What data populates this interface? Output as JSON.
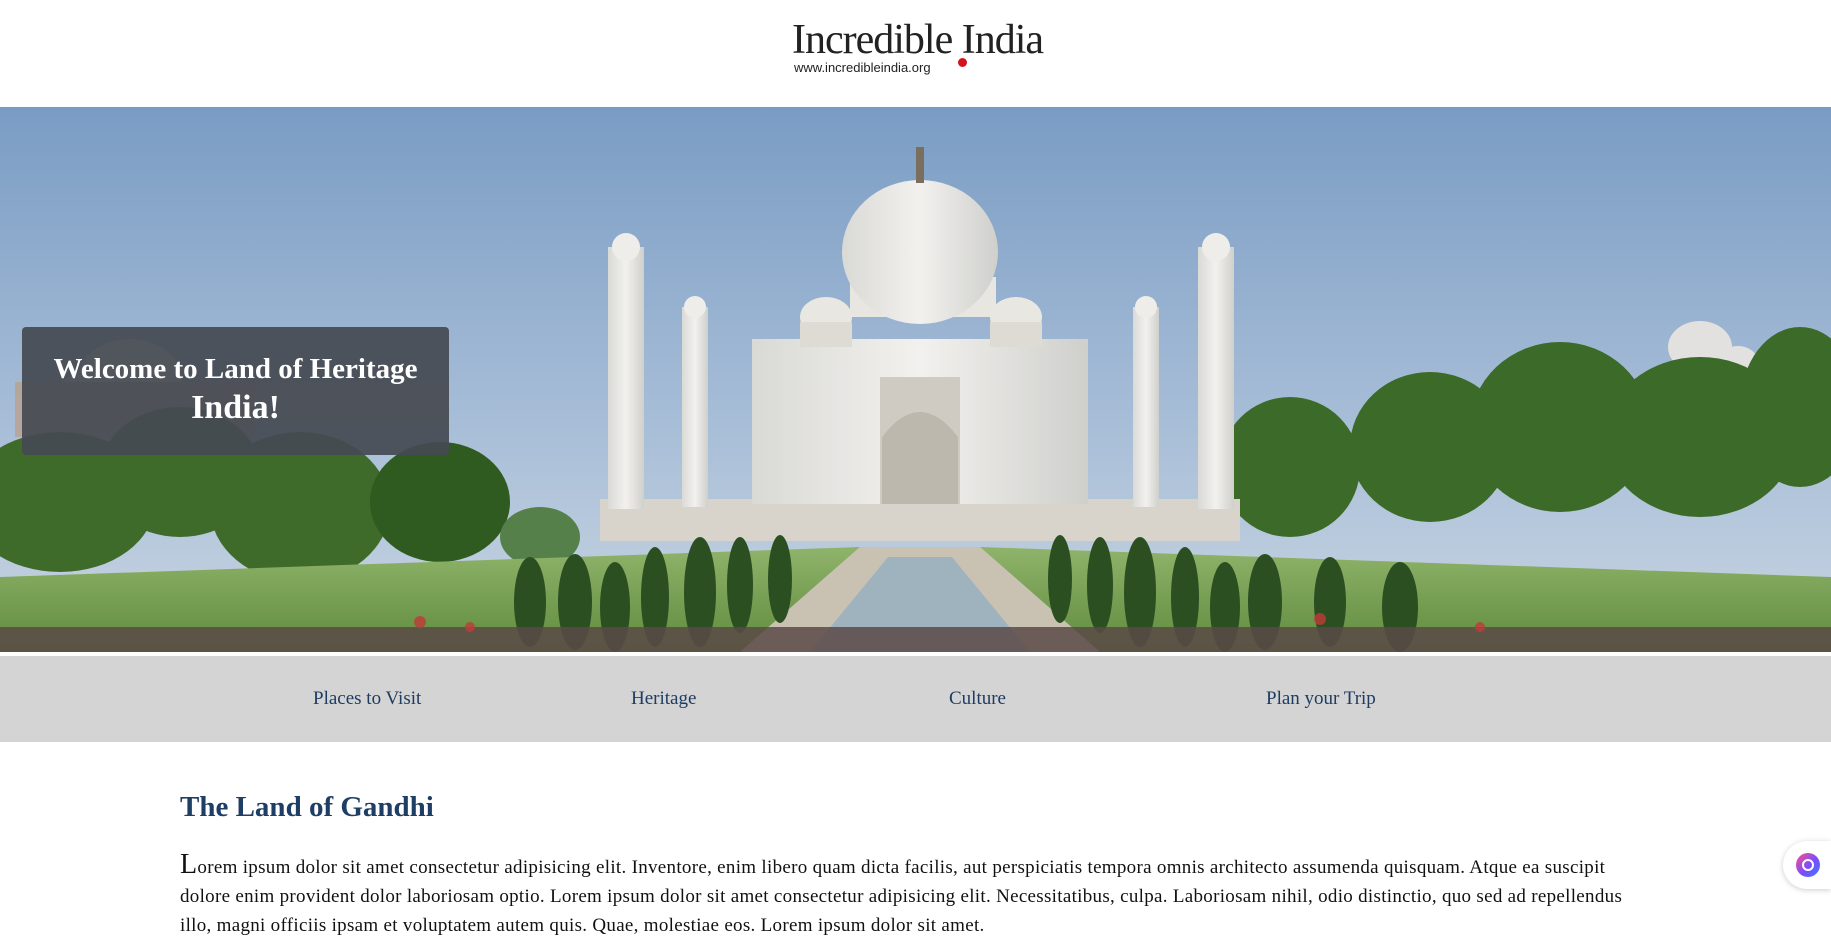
{
  "logo": {
    "title": "Incredible India",
    "url": "www.incredibleindia.org"
  },
  "hero": {
    "welcome_line1": "Welcome to Land of Heritage",
    "welcome_line2": "India!"
  },
  "nav": {
    "items": [
      {
        "label": "Places to Visit"
      },
      {
        "label": "Heritage"
      },
      {
        "label": "Culture"
      },
      {
        "label": "Plan your Trip"
      }
    ]
  },
  "main": {
    "title": "The Land of Gandhi",
    "paragraph_first_letter": "L",
    "paragraph_rest": "orem ipsum dolor sit amet consectetur adipisicing elit. Inventore, enim libero quam dicta facilis, aut perspiciatis tempora omnis architecto assumenda quisquam. Atque ea suscipit dolore enim provident dolor laboriosam optio. Lorem ipsum dolor sit amet consectetur adipisicing elit. Necessitatibus, culpa. Laboriosam nihil, odio distinctio, quo sed ad repellendus illo, magni officiis ipsam et voluptatem autem quis. Quae, molestiae eos. Lorem ipsum dolor sit amet."
  },
  "colors": {
    "nav_bg": "#d4d4d4",
    "nav_link": "#1d3c62",
    "heading": "#1e3e66",
    "logo_dot": "#d4121c"
  },
  "icons": {
    "extension": "brain-extension-icon"
  }
}
